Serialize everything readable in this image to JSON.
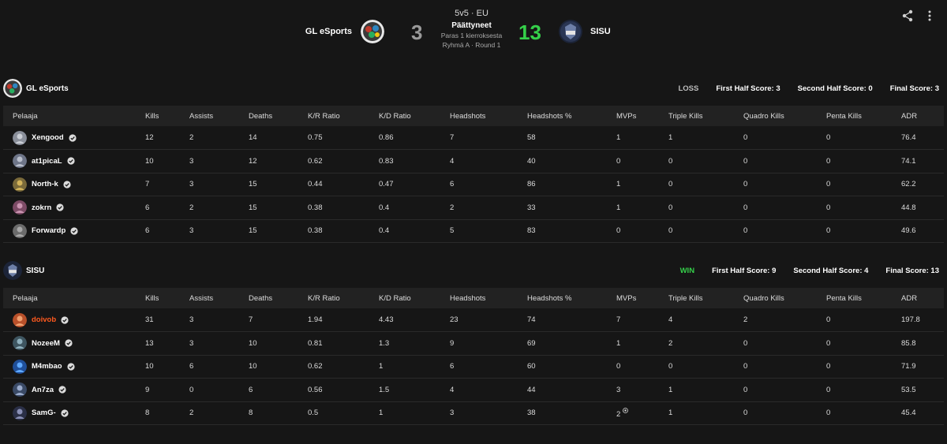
{
  "match": {
    "format": "5v5 · EU",
    "status": "Päättyneet",
    "best_of": "Paras 1 kierroksesta",
    "group_round": "Ryhmä A · Round 1",
    "team_left": {
      "name": "GL eSports",
      "score": "3",
      "logo_icon": "gl-esports-logo"
    },
    "team_right": {
      "name": "SISU",
      "score": "13",
      "logo_icon": "sisu-logo"
    },
    "loser_score_color": "#9a9a9a",
    "winner_score_color": "#35d04a"
  },
  "columns": [
    "Pelaaja",
    "Kills",
    "Assists",
    "Deaths",
    "K/R Ratio",
    "K/D Ratio",
    "Headshots",
    "Headshots %",
    "MVPs",
    "Triple Kills",
    "Quadro Kills",
    "Penta Kills",
    "ADR"
  ],
  "teams": [
    {
      "name": "GL eSports",
      "result": "LOSS",
      "first_half": "First Half Score: 3",
      "second_half": "Second Half Score: 0",
      "final": "Final Score: 3",
      "players": [
        {
          "name": "Xengood",
          "kills": "12",
          "assists": "2",
          "deaths": "14",
          "kr": "0.75",
          "kd": "0.86",
          "hs": "7",
          "hs_pct": "58",
          "mvps": "1",
          "triple": "1",
          "quadro": "0",
          "penta": "0",
          "adr": "76.4"
        },
        {
          "name": "at1picaL",
          "kills": "10",
          "assists": "3",
          "deaths": "12",
          "kr": "0.62",
          "kd": "0.83",
          "hs": "4",
          "hs_pct": "40",
          "mvps": "0",
          "triple": "0",
          "quadro": "0",
          "penta": "0",
          "adr": "74.1"
        },
        {
          "name": "North-k",
          "kills": "7",
          "assists": "3",
          "deaths": "15",
          "kr": "0.44",
          "kd": "0.47",
          "hs": "6",
          "hs_pct": "86",
          "mvps": "1",
          "triple": "0",
          "quadro": "0",
          "penta": "0",
          "adr": "62.2"
        },
        {
          "name": "zokrn",
          "kills": "6",
          "assists": "2",
          "deaths": "15",
          "kr": "0.38",
          "kd": "0.4",
          "hs": "2",
          "hs_pct": "33",
          "mvps": "1",
          "triple": "0",
          "quadro": "0",
          "penta": "0",
          "adr": "44.8"
        },
        {
          "name": "Forwardp",
          "kills": "6",
          "assists": "3",
          "deaths": "15",
          "kr": "0.38",
          "kd": "0.4",
          "hs": "5",
          "hs_pct": "83",
          "mvps": "0",
          "triple": "0",
          "quadro": "0",
          "penta": "0",
          "adr": "49.6"
        }
      ]
    },
    {
      "name": "SISU",
      "result": "WIN",
      "first_half": "First Half Score: 9",
      "second_half": "Second Half Score: 4",
      "final": "Final Score: 13",
      "players": [
        {
          "name": "doivob",
          "kills": "31",
          "assists": "3",
          "deaths": "7",
          "kr": "1.94",
          "kd": "4.43",
          "hs": "23",
          "hs_pct": "74",
          "mvps": "7",
          "triple": "4",
          "quadro": "2",
          "penta": "0",
          "adr": "197.8"
        },
        {
          "name": "NozeeM",
          "kills": "13",
          "assists": "3",
          "deaths": "10",
          "kr": "0.81",
          "kd": "1.3",
          "hs": "9",
          "hs_pct": "69",
          "mvps": "1",
          "triple": "2",
          "quadro": "0",
          "penta": "0",
          "adr": "85.8"
        },
        {
          "name": "M4mbao",
          "kills": "10",
          "assists": "6",
          "deaths": "10",
          "kr": "0.62",
          "kd": "1",
          "hs": "6",
          "hs_pct": "60",
          "mvps": "0",
          "triple": "0",
          "quadro": "0",
          "penta": "0",
          "adr": "71.9"
        },
        {
          "name": "An7za",
          "kills": "9",
          "assists": "0",
          "deaths": "6",
          "kr": "0.56",
          "kd": "1.5",
          "hs": "4",
          "hs_pct": "44",
          "mvps": "3",
          "triple": "1",
          "quadro": "0",
          "penta": "0",
          "adr": "53.5"
        },
        {
          "name": "SamG-",
          "kills": "8",
          "assists": "2",
          "deaths": "8",
          "kr": "0.5",
          "kd": "1",
          "hs": "3",
          "hs_pct": "38",
          "mvps": "2",
          "triple": "1",
          "quadro": "0",
          "penta": "0",
          "adr": "45.4"
        }
      ]
    }
  ],
  "colors": {
    "background": "#161616",
    "header_row": "#222222",
    "win": "#35d04a",
    "highlight_player": "#ff5a1f"
  }
}
